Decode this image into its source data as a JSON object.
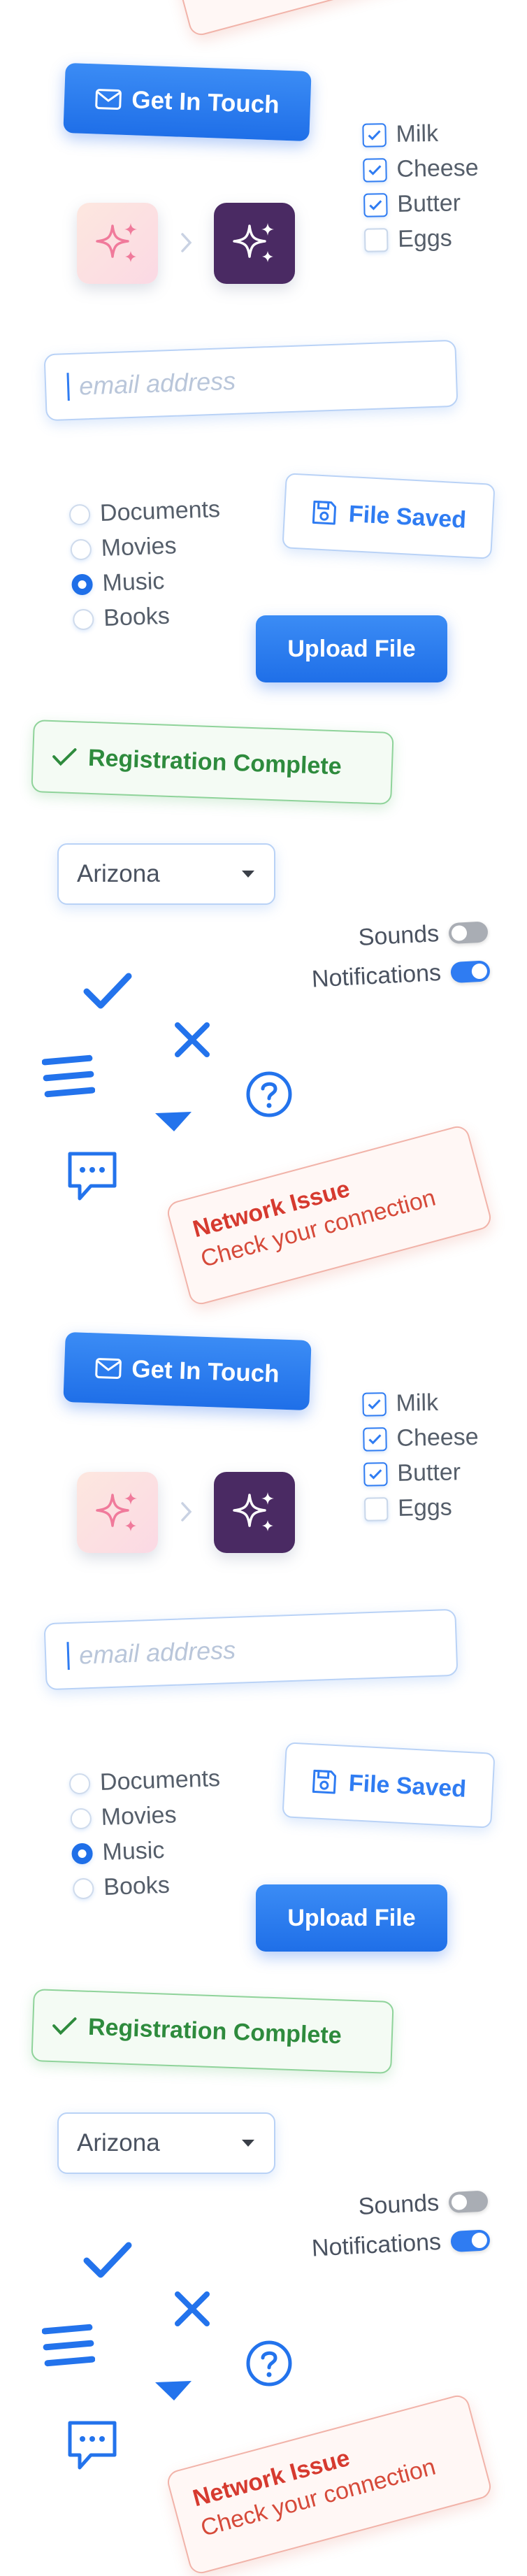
{
  "contact_button": {
    "label": "Get In Touch",
    "icon": "mail-icon"
  },
  "groceries": [
    {
      "label": "Milk",
      "checked": true
    },
    {
      "label": "Cheese",
      "checked": true
    },
    {
      "label": "Butter",
      "checked": true
    },
    {
      "label": "Eggs",
      "checked": false
    }
  ],
  "email_field": {
    "placeholder": "email address"
  },
  "media_options": [
    {
      "label": "Documents",
      "selected": false
    },
    {
      "label": "Movies",
      "selected": false
    },
    {
      "label": "Music",
      "selected": true
    },
    {
      "label": "Books",
      "selected": false
    }
  ],
  "file_saved": {
    "label": "File Saved",
    "icon": "save-icon"
  },
  "upload_button": {
    "label": "Upload File"
  },
  "registration": {
    "label": "Registration Complete",
    "icon": "check-icon"
  },
  "state_select": {
    "value": "Arizona"
  },
  "toggles": [
    {
      "label": "Sounds",
      "on": false
    },
    {
      "label": "Notifications",
      "on": true
    }
  ],
  "network_alert": {
    "title": "Network Issue",
    "message": "Check your connection"
  },
  "colors": {
    "primary": "#1f6fe8",
    "success": "#2e8b3d",
    "error": "#d63a2f"
  }
}
